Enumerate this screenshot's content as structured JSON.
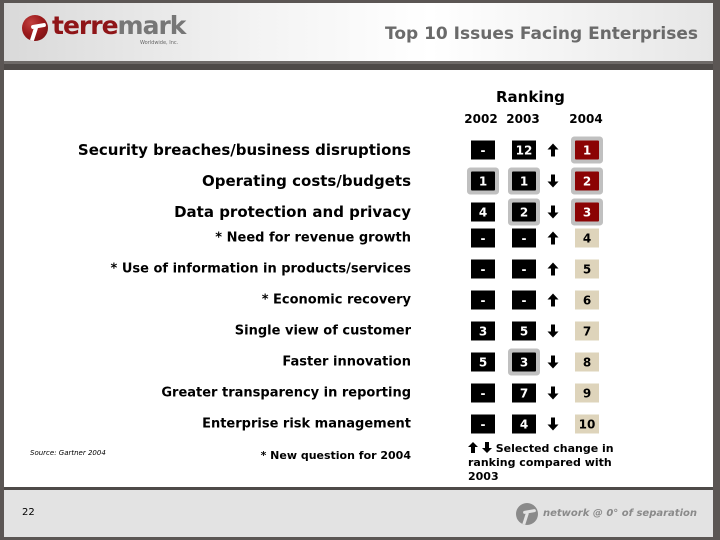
{
  "header": {
    "logo_primary": "terre",
    "logo_secondary": "mark",
    "logo_subtitle": "Worldwide, Inc.",
    "title": "Top 10 Issues Facing Enterprises"
  },
  "table": {
    "group_header": "Ranking",
    "columns": [
      "2002",
      "2003",
      "2004"
    ],
    "rows": [
      {
        "label": "Security breaches/business disruptions",
        "r2002": "-",
        "r2003": "12",
        "change": "up",
        "r2004": "1"
      },
      {
        "label": "Operating costs/budgets",
        "r2002": "1",
        "r2003": "1",
        "change": "down",
        "r2004": "2"
      },
      {
        "label": "Data protection and privacy",
        "r2002": "4",
        "r2003": "2",
        "change": "down",
        "r2004": "3"
      },
      {
        "label": "* Need for revenue growth",
        "r2002": "-",
        "r2003": "-",
        "change": "up",
        "r2004": "4"
      },
      {
        "label": "* Use of information in products/services",
        "r2002": "-",
        "r2003": "-",
        "change": "up",
        "r2004": "5"
      },
      {
        "label": "* Economic recovery",
        "r2002": "-",
        "r2003": "-",
        "change": "up",
        "r2004": "6"
      },
      {
        "label": "Single view of customer",
        "r2002": "3",
        "r2003": "5",
        "change": "down",
        "r2004": "7"
      },
      {
        "label": "Faster innovation",
        "r2002": "5",
        "r2003": "3",
        "change": "down",
        "r2004": "8"
      },
      {
        "label": "Greater transparency in reporting",
        "r2002": "-",
        "r2003": "7",
        "change": "down",
        "r2004": "9"
      },
      {
        "label": "Enterprise risk management",
        "r2002": "-",
        "r2003": "4",
        "change": "down",
        "r2004": "10"
      }
    ],
    "icons": {
      "up": "arrow-up-icon",
      "down": "arrow-down-icon"
    }
  },
  "notes": {
    "source": "Source: Gartner 2004",
    "new_question": "*  New question for 2004",
    "legend": "Selected change in ranking compared with 2003"
  },
  "footer": {
    "page_number": "22",
    "tagline": "network @ 0° of separation"
  },
  "colors": {
    "brand_red": "#8b0304",
    "top3_fill": "#8b0304",
    "others_fill": "#ded4bb",
    "history_fill": "#000000",
    "highlight": "#c0c0c0"
  }
}
